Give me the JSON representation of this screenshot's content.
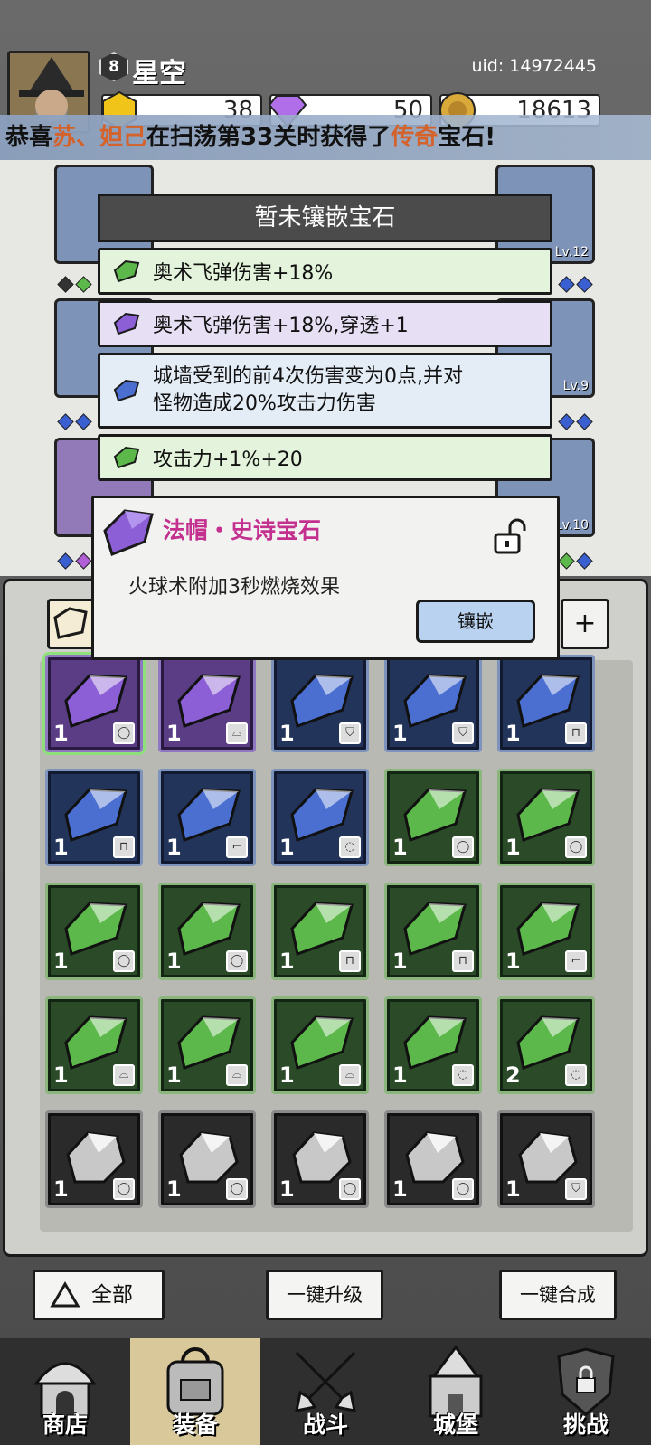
{
  "header": {
    "player_level": "8",
    "player_name": "星空",
    "uid": "uid: 14972445",
    "resources": {
      "gold": "38",
      "diamond": "50",
      "coins": "18613"
    }
  },
  "ticker": {
    "prefix": "恭喜",
    "names": "苏、妲己",
    "middle": "在扫荡第33关时获得了",
    "rarity": "传奇",
    "suffix": "宝石!"
  },
  "equipment": {
    "slot_levels": [
      "Lv.12",
      "Lv.9",
      "Lv.10"
    ]
  },
  "gem_panel": {
    "title": "暂未镶嵌宝石",
    "effects": [
      {
        "color": "green",
        "text": "奥术飞弹伤害+18%"
      },
      {
        "color": "purple",
        "text": "奥术飞弹伤害+18%,穿透+1"
      },
      {
        "color": "blue",
        "text": "城墙受到的前4次伤害变为0点,并对怪物造成20%攻击力伤害"
      },
      {
        "color": "green",
        "text": "攻击力+1%+20"
      }
    ]
  },
  "tooltip": {
    "title": "法帽・史诗宝石",
    "description": "火球术附加3秒燃烧效果",
    "embed_button": "镶嵌"
  },
  "inventory": {
    "plus_label": "+",
    "rows": [
      [
        {
          "c": "purple",
          "n": "1",
          "s": "ring"
        },
        {
          "c": "purple",
          "n": "1",
          "s": "hat"
        },
        {
          "c": "blue",
          "n": "1",
          "s": "armor"
        },
        {
          "c": "blue",
          "n": "1",
          "s": "armor"
        },
        {
          "c": "blue",
          "n": "1",
          "s": "boots"
        }
      ],
      [
        {
          "c": "blue",
          "n": "1",
          "s": "boots"
        },
        {
          "c": "blue",
          "n": "1",
          "s": "staff"
        },
        {
          "c": "blue",
          "n": "1",
          "s": "necklace"
        },
        {
          "c": "green",
          "n": "1",
          "s": "ring"
        },
        {
          "c": "green",
          "n": "1",
          "s": "ring"
        }
      ],
      [
        {
          "c": "green",
          "n": "1",
          "s": "ring"
        },
        {
          "c": "green",
          "n": "1",
          "s": "ring"
        },
        {
          "c": "green",
          "n": "1",
          "s": "boots"
        },
        {
          "c": "green",
          "n": "1",
          "s": "boots"
        },
        {
          "c": "green",
          "n": "1",
          "s": "staff"
        }
      ],
      [
        {
          "c": "green",
          "n": "1",
          "s": "hat"
        },
        {
          "c": "green",
          "n": "1",
          "s": "hat"
        },
        {
          "c": "green",
          "n": "1",
          "s": "hat"
        },
        {
          "c": "green",
          "n": "1",
          "s": "necklace"
        },
        {
          "c": "green",
          "n": "2",
          "s": "necklace"
        }
      ],
      [
        {
          "c": "gray",
          "n": "1",
          "s": "ring"
        },
        {
          "c": "gray",
          "n": "1",
          "s": "ring"
        },
        {
          "c": "gray",
          "n": "1",
          "s": "ring"
        },
        {
          "c": "gray",
          "n": "1",
          "s": "ring"
        },
        {
          "c": "gray",
          "n": "1",
          "s": "armor"
        }
      ]
    ]
  },
  "actions": {
    "filter_all": "全部",
    "upgrade_all": "一键升级",
    "merge_all": "一键合成"
  },
  "tabs": [
    {
      "label": "商店",
      "icon": "shop-icon"
    },
    {
      "label": "装备",
      "icon": "bag-icon"
    },
    {
      "label": "战斗",
      "icon": "swords-icon"
    },
    {
      "label": "城堡",
      "icon": "castle-icon"
    },
    {
      "label": "挑战",
      "icon": "challenge-icon"
    }
  ],
  "colors": {
    "purple": "#8c5fd6",
    "blue": "#4a6fd0",
    "green": "#5cb84a",
    "gray": "#c8c8c8",
    "highlight": "#d4622a",
    "epic_title": "#c4308f"
  }
}
